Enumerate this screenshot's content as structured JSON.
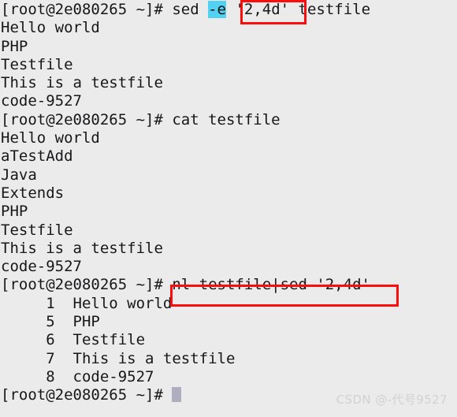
{
  "terminal": {
    "shell_prompt": "[root@2e080265 ~]# ",
    "background_color": "#ebebeb",
    "text_color": "#17171a",
    "highlight_cyan": "#52d1f2",
    "annotation_red": "#fb0d0d",
    "cursor_color": "#aeaebe",
    "lines": [
      {
        "type": "command",
        "prompt": "[root@2e080265 ~]# ",
        "parts": [
          {
            "text": "sed ",
            "style": "plain"
          },
          {
            "text": "-e",
            "style": "highlight-cyan"
          },
          {
            "text": " ",
            "style": "plain"
          },
          {
            "text": "'2,4d'",
            "style": "boxed-red"
          },
          {
            "text": " testfile",
            "style": "plain"
          }
        ],
        "full_text": "sed -e '2,4d' testfile"
      },
      {
        "type": "output",
        "text": "Hello world"
      },
      {
        "type": "output",
        "text": "PHP"
      },
      {
        "type": "output",
        "text": "Testfile"
      },
      {
        "type": "output",
        "text": "This is a testfile"
      },
      {
        "type": "output",
        "text": "code-9527"
      },
      {
        "type": "command",
        "prompt": "[root@2e080265 ~]# ",
        "parts": [
          {
            "text": "cat testfile",
            "style": "plain"
          }
        ],
        "full_text": "cat testfile"
      },
      {
        "type": "output",
        "text": "Hello world"
      },
      {
        "type": "output",
        "text": "aTestAdd"
      },
      {
        "type": "output",
        "text": "Java"
      },
      {
        "type": "output",
        "text": "Extends"
      },
      {
        "type": "output",
        "text": "PHP"
      },
      {
        "type": "output",
        "text": "Testfile"
      },
      {
        "type": "output",
        "text": "This is a testfile"
      },
      {
        "type": "output",
        "text": "code-9527"
      },
      {
        "type": "command",
        "prompt": "[root@2e080265 ~]# ",
        "parts": [
          {
            "text": "nl testfile|sed '2,4d'",
            "style": "boxed-red-2"
          }
        ],
        "full_text": "nl testfile|sed '2,4d'"
      },
      {
        "type": "output",
        "text": "     1\tHello world",
        "number": "1",
        "content": "Hello world"
      },
      {
        "type": "output",
        "text": "     5\tPHP",
        "number": "5",
        "content": "PHP"
      },
      {
        "type": "output",
        "text": "     6\tTestfile",
        "number": "6",
        "content": "Testfile"
      },
      {
        "type": "output",
        "text": "     7\tThis is a testfile",
        "number": "7",
        "content": "This is a testfile"
      },
      {
        "type": "output",
        "text": "     8\tcode-9527",
        "number": "8",
        "content": "code-9527"
      },
      {
        "type": "prompt_only",
        "prompt": "[root@2e080265 ~]# ",
        "cursor": true
      }
    ],
    "rendered": {
      "l1_prompt": "[root@2e080265 ~]# ",
      "l1_sed": "sed ",
      "l1_flag": "-e",
      "l1_space": " ",
      "l1_range": "'2,4d'",
      "l1_file": " testfile",
      "l2": "Hello world",
      "l3": "PHP",
      "l4": "Testfile",
      "l5": "This is a testfile",
      "l6": "code-9527",
      "l7_prompt": "[root@2e080265 ~]# ",
      "l7_cmd": "cat testfile",
      "l8": "Hello world",
      "l9": "aTestAdd",
      "l10": "Java",
      "l11": "Extends",
      "l12": "PHP",
      "l13": "Testfile",
      "l14": "This is a testfile",
      "l15": "code-9527",
      "l16_prompt": "[root@2e080265 ~]# ",
      "l16_cmd": "nl testfile|sed '2,4d'",
      "l17": "     1  Hello world",
      "l18": "     5  PHP",
      "l19": "     6  Testfile",
      "l20": "     7  This is a testfile",
      "l21": "     8  code-9527",
      "l22_prompt": "[root@2e080265 ~]# "
    }
  },
  "watermark": {
    "text": "CSDN @-代号9527"
  }
}
